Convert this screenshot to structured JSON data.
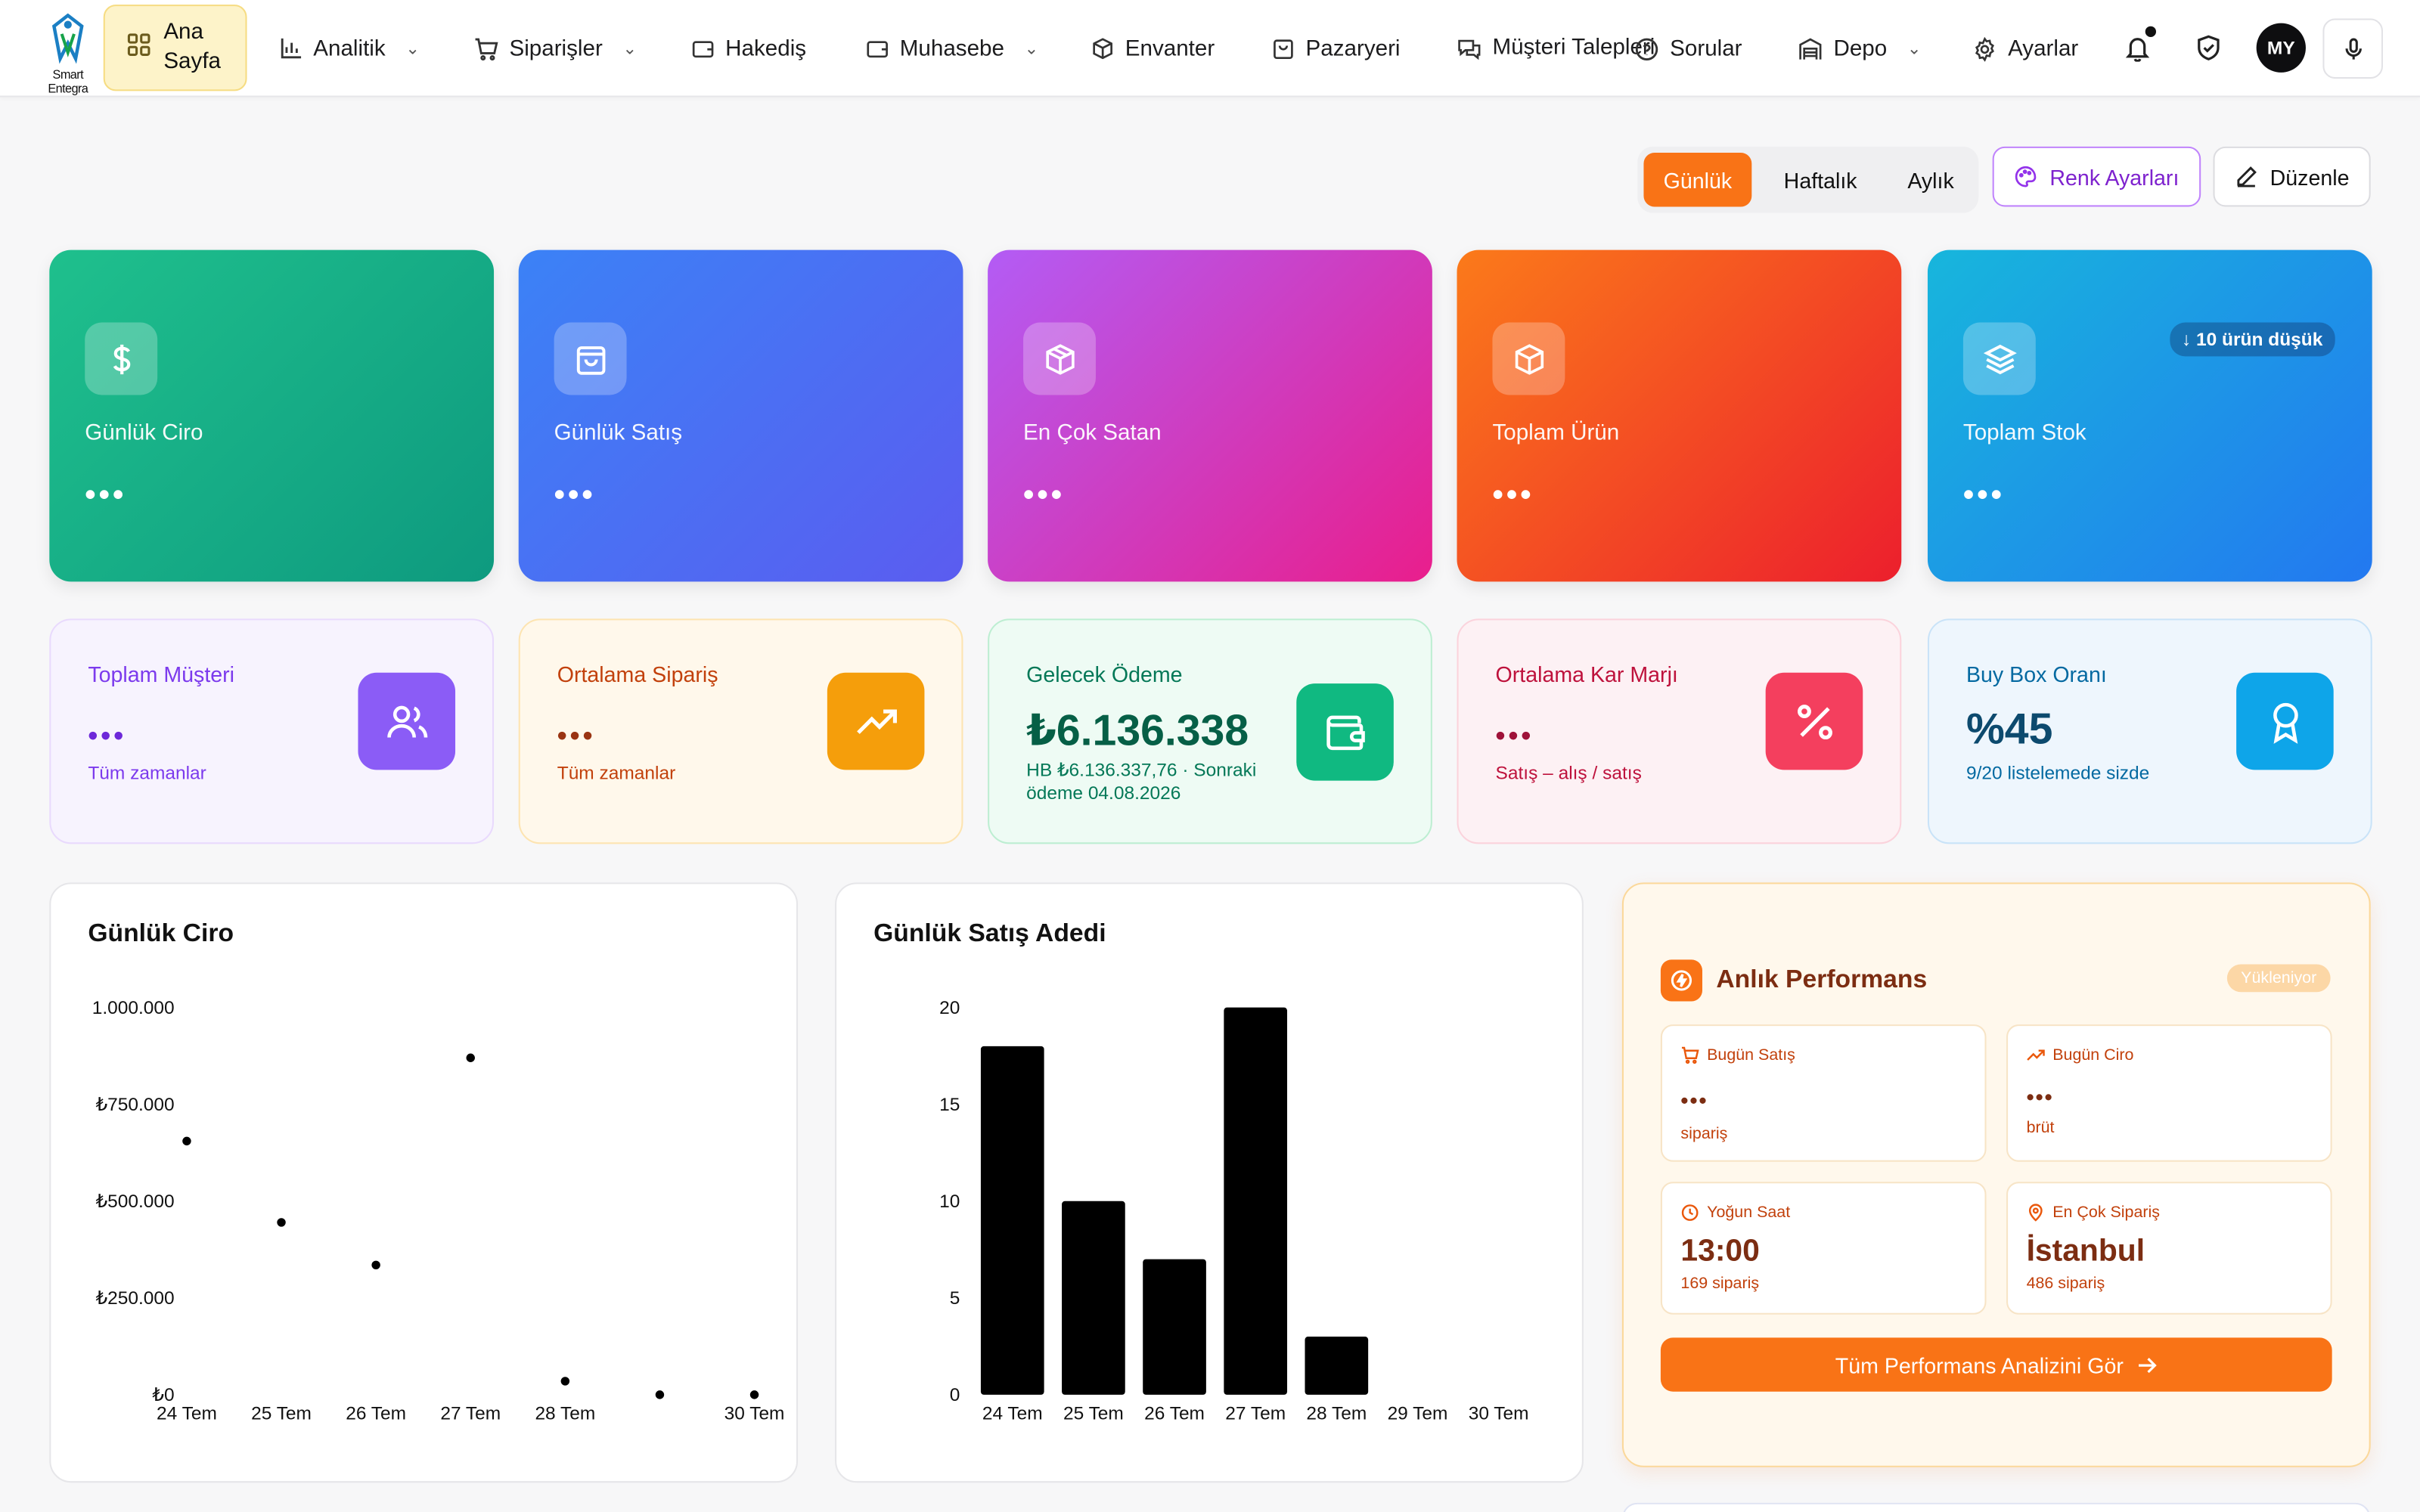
{
  "nav": {
    "logo_text": "Smart Entegra",
    "home": "Ana Sayfa",
    "items": [
      "Analitik",
      "Siparişler",
      "Hakediş",
      "Muhasebe",
      "Envanter",
      "Pazaryeri",
      "Müşteri Talepleri",
      "Sorular",
      "Depo",
      "Ayarlar"
    ],
    "avatar": "MY"
  },
  "toolbar": {
    "periods": [
      "Günlük",
      "Haftalık",
      "Aylık"
    ],
    "active_period": "Günlük",
    "color_settings": "Renk Ayarları",
    "edit": "Düzenle"
  },
  "kpis": [
    {
      "title": "Günlük Ciro",
      "value": "•••",
      "icon": "dollar-icon"
    },
    {
      "title": "Günlük Satış",
      "value": "•••",
      "icon": "shopping-bag-icon"
    },
    {
      "title": "En Çok Satan",
      "value": "•••",
      "icon": "package-icon"
    },
    {
      "title": "Toplam Ürün",
      "value": "•••",
      "icon": "package-icon"
    },
    {
      "title": "Toplam Stok",
      "value": "•••",
      "icon": "layers-icon",
      "badge": "↓ 10 ürün düşük"
    }
  ],
  "stats": [
    {
      "title": "Toplam Müşteri",
      "value": "•••",
      "sub": "Tüm zamanlar",
      "color": "#7c3aed",
      "accent": "#8b5cf6"
    },
    {
      "title": "Ortalama Sipariş",
      "value": "•••",
      "sub": "Tüm zamanlar",
      "color": "#c2410c",
      "accent": "#f59e0b"
    },
    {
      "title": "Gelecek Ödeme",
      "value": "₺6.136.338",
      "sub": "HB ₺6.136.337,76 · Sonraki ödeme 04.08.2026",
      "color": "#047857",
      "accent": "#10b981"
    },
    {
      "title": "Ortalama Kar Marjı",
      "value": "•••",
      "sub": "Satış – alış / satış",
      "color": "#be123c",
      "accent": "#f43f5e"
    },
    {
      "title": "Buy Box Oranı",
      "value": "%45",
      "sub": "9/20 listelemede sizde",
      "color": "#0369a1",
      "accent": "#0ea5e9"
    }
  ],
  "chart_data": [
    {
      "type": "scatter",
      "title": "Günlük Ciro",
      "categories": [
        "24 Tem",
        "25 Tem",
        "26 Tem",
        "27 Tem",
        "28 Tem",
        "29 Tem",
        "30 Tem"
      ],
      "x_labels": [
        "24 Tem",
        "25 Tem",
        "26 Tem",
        "27 Tem",
        "28 Tem",
        "",
        "30 Tem"
      ],
      "values": [
        655000,
        445000,
        335000,
        870000,
        35000,
        0,
        0
      ],
      "yticks": [
        "₺0",
        "₺250.000",
        "₺500.000",
        "₺750.000",
        "1.000.000"
      ],
      "ylim": [
        0,
        1000000
      ]
    },
    {
      "type": "bar",
      "title": "Günlük Satış Adedi",
      "categories": [
        "24 Tem",
        "25 Tem",
        "26 Tem",
        "27 Tem",
        "28 Tem",
        "29 Tem",
        "30 Tem"
      ],
      "values": [
        18,
        10,
        7,
        20,
        3,
        0,
        0
      ],
      "yticks": [
        "0",
        "5",
        "10",
        "15",
        "20"
      ],
      "ylim": [
        0,
        20
      ]
    }
  ],
  "performance": {
    "title": "Anlık Performans",
    "status": "Yükleniyor",
    "cards": [
      {
        "label": "Bugün Satış",
        "value": "•••",
        "sub": "sipariş"
      },
      {
        "label": "Bugün Ciro",
        "value": "•••",
        "sub": "brüt"
      },
      {
        "label": "Yoğun Saat",
        "value": "13:00",
        "sub": "169 sipariş"
      },
      {
        "label": "En Çok Sipariş",
        "value": "İstanbul",
        "sub": "486 sipariş"
      }
    ],
    "cta": "Tüm Performans Analizini Gör"
  }
}
